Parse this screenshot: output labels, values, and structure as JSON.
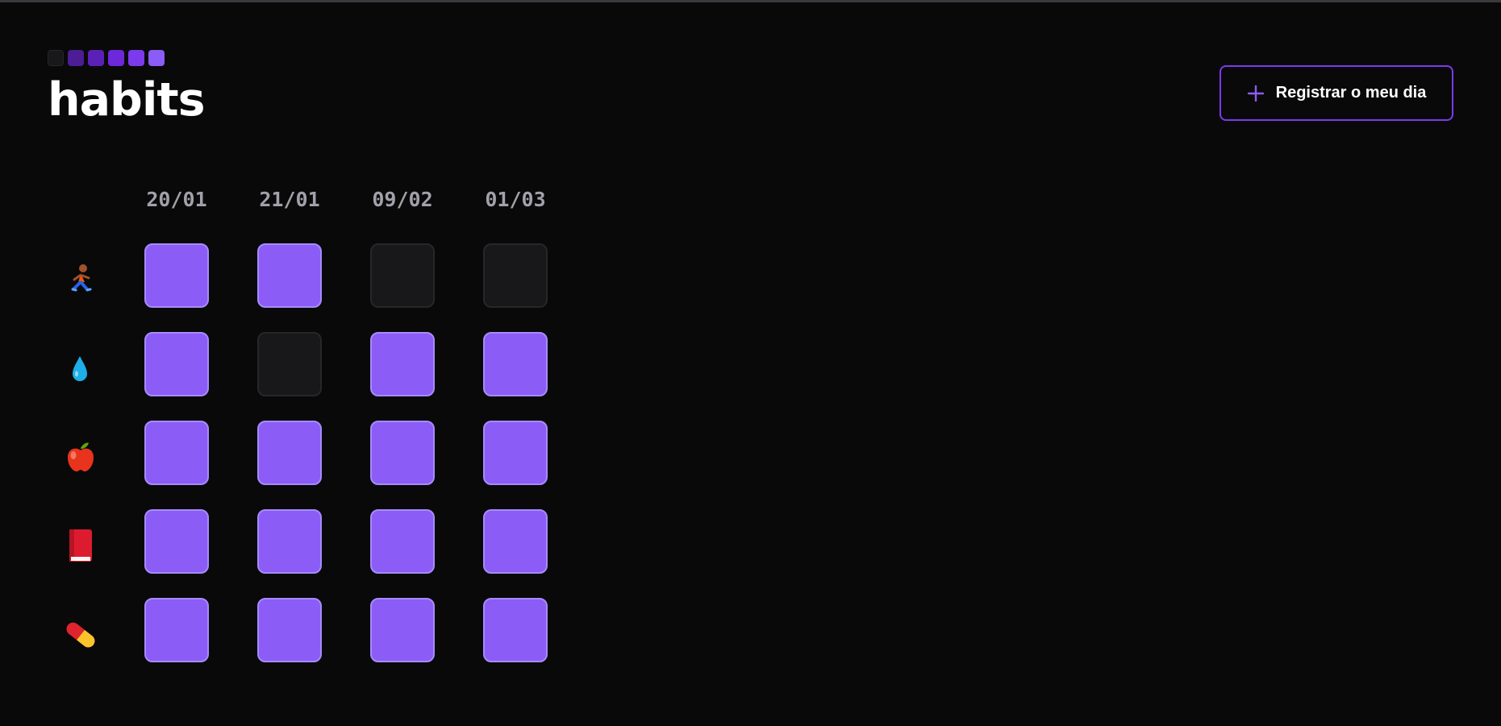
{
  "app": {
    "title": "habits",
    "logo_squares": [
      "#18181b",
      "#4c1d95",
      "#5b21b6",
      "#6d28d9",
      "#7c3aed",
      "#8b5cf6"
    ],
    "accent_color": "#8b5cf6"
  },
  "header": {
    "register_label": "Registrar o meu dia",
    "register_icon": "plus-icon"
  },
  "dates": [
    "20/01",
    "21/01",
    "09/02",
    "01/03"
  ],
  "habits": [
    {
      "icon": "running-person-icon",
      "days": [
        true,
        true,
        false,
        false
      ]
    },
    {
      "icon": "water-drop-icon",
      "days": [
        true,
        false,
        true,
        true
      ]
    },
    {
      "icon": "apple-icon",
      "days": [
        true,
        true,
        true,
        true
      ]
    },
    {
      "icon": "book-icon",
      "days": [
        true,
        true,
        true,
        true
      ]
    },
    {
      "icon": "pill-icon",
      "days": [
        true,
        true,
        true,
        true
      ]
    }
  ]
}
